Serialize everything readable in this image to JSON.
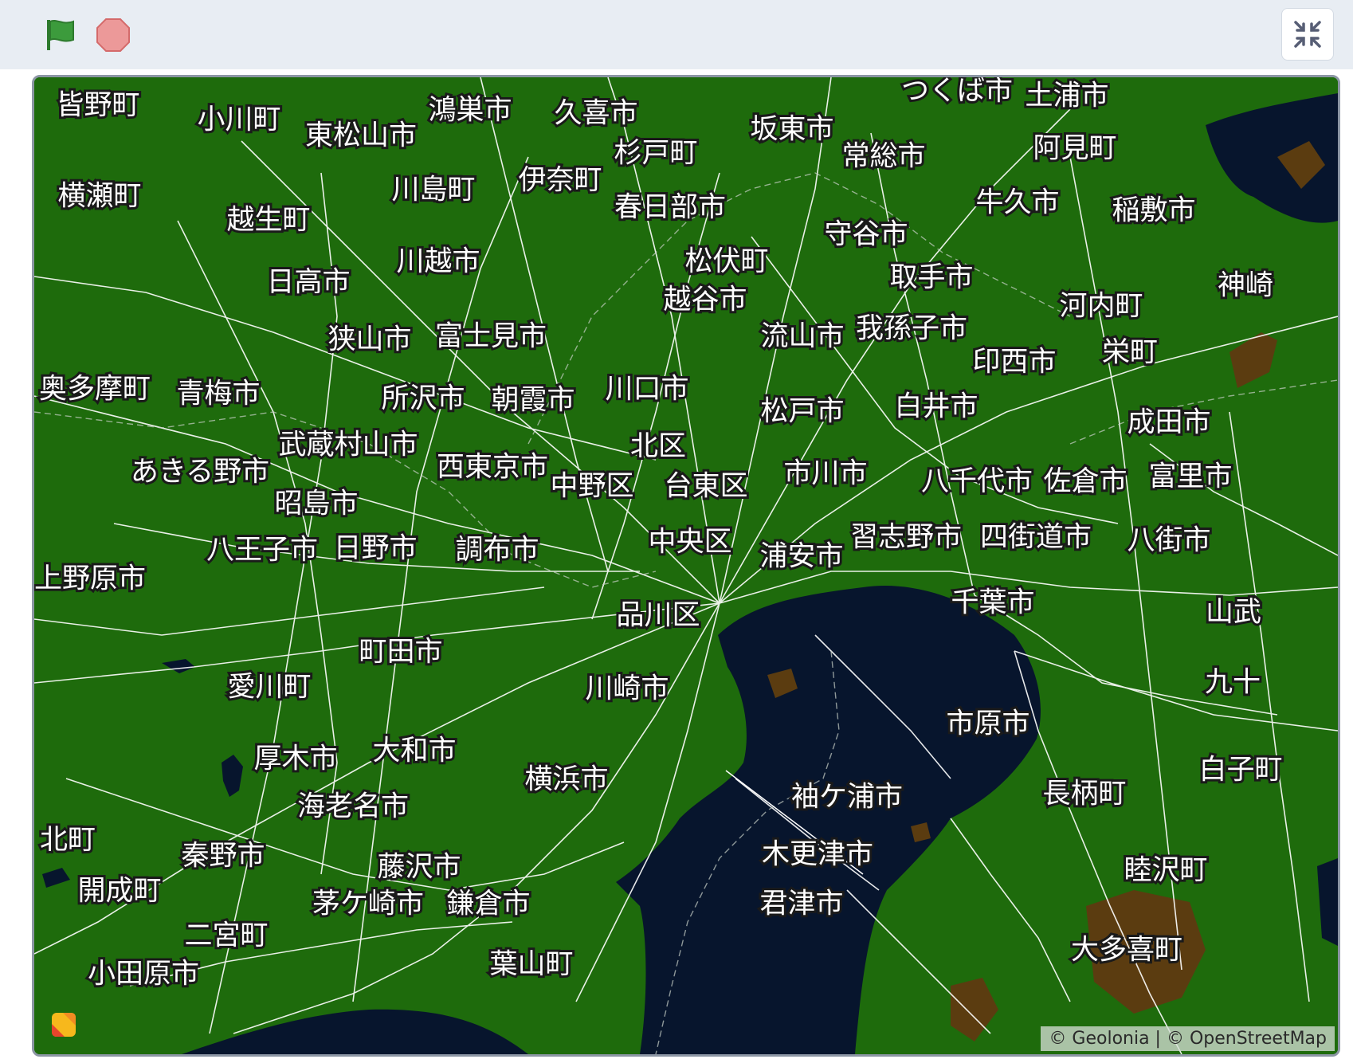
{
  "toolbar": {
    "icons": [
      "green-flag-icon",
      "stop-icon",
      "fullscreen-exit-icon"
    ],
    "flag_color": "#3c9b3c",
    "stop_color": "#ec9999"
  },
  "map": {
    "colors": {
      "land": "#1e6b0c",
      "water": "#07152d",
      "road": "#ffffff",
      "bare": "#5b3c10"
    },
    "places": [
      "皆野町",
      "小川町",
      "東松山市",
      "鴻巣市",
      "久喜市",
      "つくば市",
      "土浦市",
      "坂東市",
      "杉戸町",
      "常総市",
      "阿見町",
      "横瀬町",
      "越生町",
      "川島町",
      "伊奈町",
      "春日部市",
      "牛久市",
      "稲敷市",
      "守谷市",
      "日高市",
      "川越市",
      "松伏町",
      "取手市",
      "越谷市",
      "神崎",
      "河内町",
      "狭山市",
      "富士見市",
      "流山市",
      "我孫子市",
      "栄町",
      "印西市",
      "奥多摩町",
      "青梅市",
      "所沢市",
      "朝霞市",
      "川口市",
      "松戸市",
      "白井市",
      "成田市",
      "武蔵村山市",
      "北区",
      "あきる野市",
      "西東京市",
      "市川市",
      "中野区",
      "台東区",
      "八千代市",
      "佐倉市",
      "富里市",
      "昭島市",
      "中央区",
      "習志野市",
      "四街道市",
      "八街市",
      "八王子市",
      "日野市",
      "調布市",
      "浦安市",
      "上野原市",
      "品川区",
      "千葉市",
      "山武",
      "町田市",
      "川崎市",
      "愛川町",
      "九十",
      "市原市",
      "厚木市",
      "大和市",
      "白子町",
      "横浜市",
      "袖ケ浦市",
      "長柄町",
      "海老名市",
      "北町",
      "秦野市",
      "木更津市",
      "藤沢市",
      "睦沢町",
      "開成町",
      "茅ケ崎市",
      "鎌倉市",
      "君津市",
      "二宮町",
      "大多喜町",
      "葉山町",
      "小田原市"
    ],
    "attribution": "© Geolonia | © OpenStreetMap"
  }
}
